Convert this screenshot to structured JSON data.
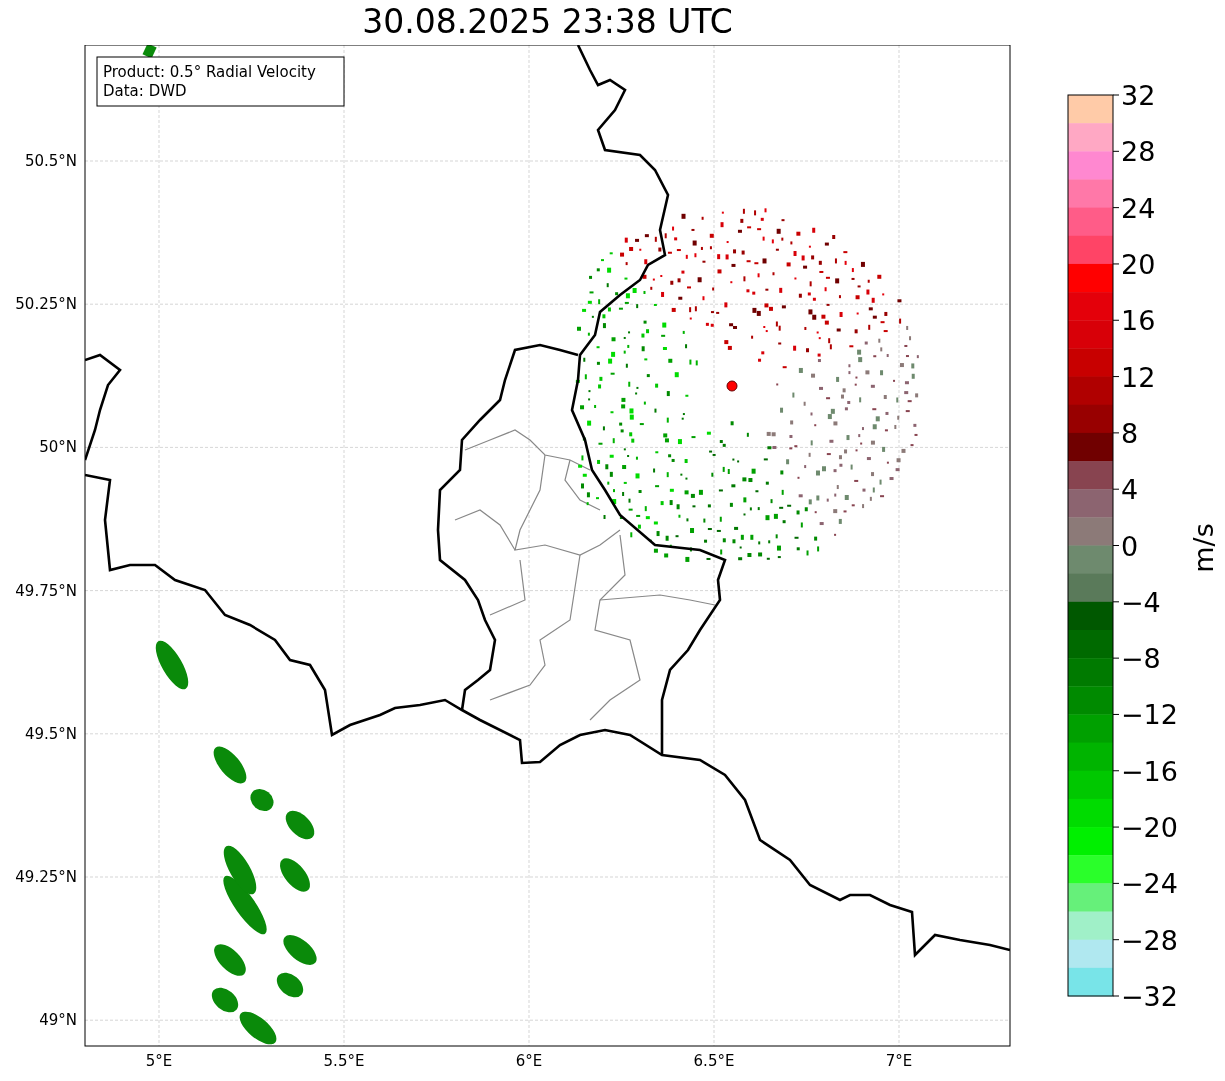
{
  "title": "30.08.2025 23:38 UTC",
  "map": {
    "legend": [
      "Product: 0.5° Radial Velocity",
      "Data: DWD"
    ],
    "x_ticks": [
      "5°E",
      "5.5°E",
      "6°E",
      "6.5°E",
      "7°E"
    ],
    "y_ticks": [
      "50.5°N",
      "50.25°N",
      "50°N",
      "49.75°N",
      "49.5°N",
      "49.25°N",
      "49°N"
    ]
  },
  "colorbar": {
    "label": "m/s",
    "ticks": [
      "32",
      "28",
      "24",
      "20",
      "16",
      "12",
      "8",
      "4",
      "0",
      "−4",
      "−8",
      "−12",
      "−16",
      "−20",
      "−24",
      "−28",
      "−32"
    ],
    "segments": [
      {
        "color": "#ffcba8"
      },
      {
        "color": "#ffa8c4"
      },
      {
        "color": "#ff88d0"
      },
      {
        "color": "#ff78a8"
      },
      {
        "color": "#ff5c88"
      },
      {
        "color": "#ff4466"
      },
      {
        "color": "#ff0000"
      },
      {
        "color": "#e4000a"
      },
      {
        "color": "#d80008"
      },
      {
        "color": "#c80000"
      },
      {
        "color": "#b00000"
      },
      {
        "color": "#980000"
      },
      {
        "color": "#700000"
      },
      {
        "color": "#884450"
      },
      {
        "color": "#8c6470"
      },
      {
        "color": "#8c7a78"
      },
      {
        "color": "#6e8a6e"
      },
      {
        "color": "#5a7a5a"
      },
      {
        "color": "#005800"
      },
      {
        "color": "#006a00"
      },
      {
        "color": "#007a00"
      },
      {
        "color": "#008a00"
      },
      {
        "color": "#00a000"
      },
      {
        "color": "#00b400"
      },
      {
        "color": "#00c800"
      },
      {
        "color": "#00dc00"
      },
      {
        "color": "#00f000"
      },
      {
        "color": "#2aff2a"
      },
      {
        "color": "#66f07a"
      },
      {
        "color": "#a0f0c8"
      },
      {
        "color": "#b0e8f0"
      },
      {
        "color": "#78e4e8"
      }
    ]
  }
}
